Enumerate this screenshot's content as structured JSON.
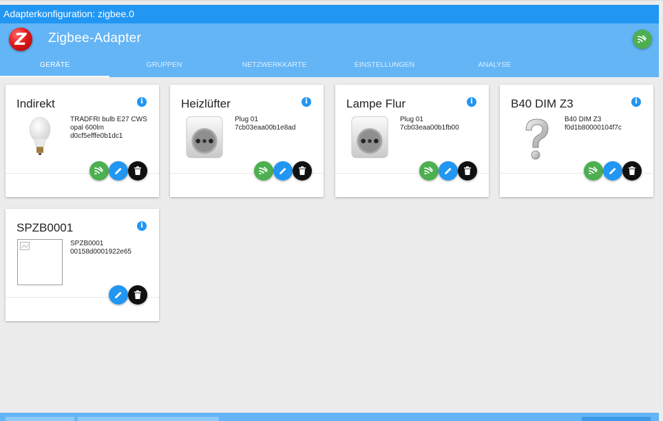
{
  "window": {
    "title": "Adapterkonfiguration: zigbee.0"
  },
  "header": {
    "app_title": "Zigbee-Adapter",
    "logo_letter": "Z",
    "tabs": [
      {
        "label": "GERÄTE",
        "active": true
      },
      {
        "label": "GRUPPEN",
        "active": false
      },
      {
        "label": "NETZWERKKARTE",
        "active": false
      },
      {
        "label": "EINSTELLUNGEN",
        "active": false
      },
      {
        "label": "ANALYSE",
        "active": false
      }
    ]
  },
  "info_glyph": "i",
  "devices": [
    {
      "name": "Indirekt",
      "model": "TRADFRI bulb E27 CWS opal 600lm",
      "id": "d0cf5efffe0b1dc1",
      "image": "bulb-icon",
      "zigbee_button": true
    },
    {
      "name": "Heizlüfter",
      "model": "Plug 01",
      "id": "7cb03eaa00b1e8ad",
      "image": "plug-icon",
      "zigbee_button": true
    },
    {
      "name": "Lampe Flur",
      "model": "Plug 01",
      "id": "7cb03eaa00b1fb00",
      "image": "plug-icon",
      "zigbee_button": true
    },
    {
      "name": "B40 DIM Z3",
      "model": "B40 DIM Z3",
      "id": "f0d1b80000104f7c",
      "image": "unknown-device-icon",
      "zigbee_button": true
    },
    {
      "name": "SPZB0001",
      "model": "SPZB0001",
      "id": "00158d0001922e65",
      "image": "broken-image-icon",
      "zigbee_button": false
    }
  ],
  "colors": {
    "titlebar": "#2196f3",
    "header": "#64b5f6",
    "zigbee_green": "#4caf50",
    "edit_blue": "#2196f3",
    "delete_black": "#111111"
  }
}
